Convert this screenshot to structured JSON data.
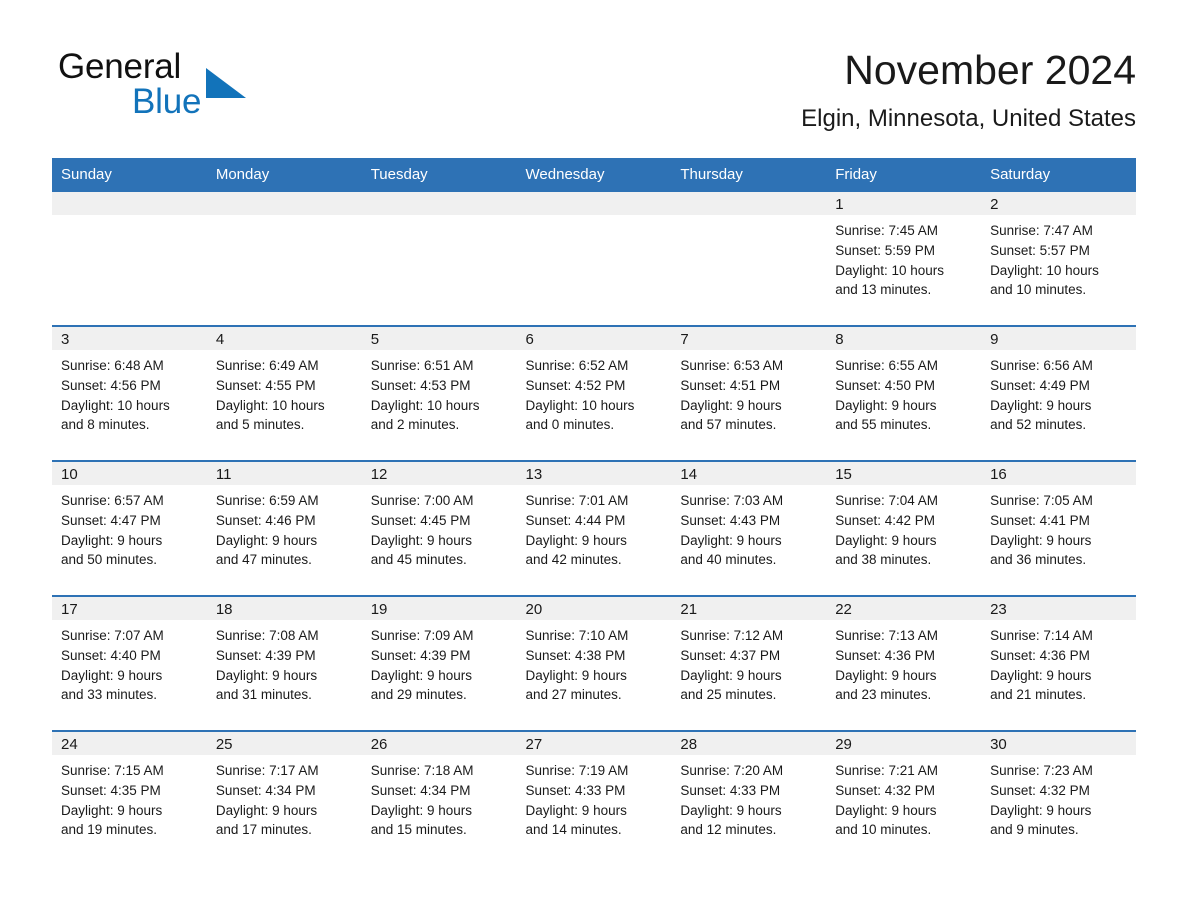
{
  "brand": {
    "line1": "General",
    "line2": "Blue",
    "accent_color": "#1273ba"
  },
  "header": {
    "title": "November 2024",
    "subtitle": "Elgin, Minnesota, United States"
  },
  "theme": {
    "header_row_bg": "#2e72b5",
    "date_band_bg": "#f0f0f0",
    "separator_color": "#2e72b5",
    "text_color": "#1a1a1a"
  },
  "weekdays": [
    "Sunday",
    "Monday",
    "Tuesday",
    "Wednesday",
    "Thursday",
    "Friday",
    "Saturday"
  ],
  "weeks": [
    [
      {
        "date": "",
        "empty": true
      },
      {
        "date": "",
        "empty": true
      },
      {
        "date": "",
        "empty": true
      },
      {
        "date": "",
        "empty": true
      },
      {
        "date": "",
        "empty": true
      },
      {
        "date": "1",
        "sunrise": "Sunrise: 7:45 AM",
        "sunset": "Sunset: 5:59 PM",
        "daylight_line1": "Daylight: 10 hours",
        "daylight_line2": "and 13 minutes."
      },
      {
        "date": "2",
        "sunrise": "Sunrise: 7:47 AM",
        "sunset": "Sunset: 5:57 PM",
        "daylight_line1": "Daylight: 10 hours",
        "daylight_line2": "and 10 minutes."
      }
    ],
    [
      {
        "date": "3",
        "sunrise": "Sunrise: 6:48 AM",
        "sunset": "Sunset: 4:56 PM",
        "daylight_line1": "Daylight: 10 hours",
        "daylight_line2": "and 8 minutes."
      },
      {
        "date": "4",
        "sunrise": "Sunrise: 6:49 AM",
        "sunset": "Sunset: 4:55 PM",
        "daylight_line1": "Daylight: 10 hours",
        "daylight_line2": "and 5 minutes."
      },
      {
        "date": "5",
        "sunrise": "Sunrise: 6:51 AM",
        "sunset": "Sunset: 4:53 PM",
        "daylight_line1": "Daylight: 10 hours",
        "daylight_line2": "and 2 minutes."
      },
      {
        "date": "6",
        "sunrise": "Sunrise: 6:52 AM",
        "sunset": "Sunset: 4:52 PM",
        "daylight_line1": "Daylight: 10 hours",
        "daylight_line2": "and 0 minutes."
      },
      {
        "date": "7",
        "sunrise": "Sunrise: 6:53 AM",
        "sunset": "Sunset: 4:51 PM",
        "daylight_line1": "Daylight: 9 hours",
        "daylight_line2": "and 57 minutes."
      },
      {
        "date": "8",
        "sunrise": "Sunrise: 6:55 AM",
        "sunset": "Sunset: 4:50 PM",
        "daylight_line1": "Daylight: 9 hours",
        "daylight_line2": "and 55 minutes."
      },
      {
        "date": "9",
        "sunrise": "Sunrise: 6:56 AM",
        "sunset": "Sunset: 4:49 PM",
        "daylight_line1": "Daylight: 9 hours",
        "daylight_line2": "and 52 minutes."
      }
    ],
    [
      {
        "date": "10",
        "sunrise": "Sunrise: 6:57 AM",
        "sunset": "Sunset: 4:47 PM",
        "daylight_line1": "Daylight: 9 hours",
        "daylight_line2": "and 50 minutes."
      },
      {
        "date": "11",
        "sunrise": "Sunrise: 6:59 AM",
        "sunset": "Sunset: 4:46 PM",
        "daylight_line1": "Daylight: 9 hours",
        "daylight_line2": "and 47 minutes."
      },
      {
        "date": "12",
        "sunrise": "Sunrise: 7:00 AM",
        "sunset": "Sunset: 4:45 PM",
        "daylight_line1": "Daylight: 9 hours",
        "daylight_line2": "and 45 minutes."
      },
      {
        "date": "13",
        "sunrise": "Sunrise: 7:01 AM",
        "sunset": "Sunset: 4:44 PM",
        "daylight_line1": "Daylight: 9 hours",
        "daylight_line2": "and 42 minutes."
      },
      {
        "date": "14",
        "sunrise": "Sunrise: 7:03 AM",
        "sunset": "Sunset: 4:43 PM",
        "daylight_line1": "Daylight: 9 hours",
        "daylight_line2": "and 40 minutes."
      },
      {
        "date": "15",
        "sunrise": "Sunrise: 7:04 AM",
        "sunset": "Sunset: 4:42 PM",
        "daylight_line1": "Daylight: 9 hours",
        "daylight_line2": "and 38 minutes."
      },
      {
        "date": "16",
        "sunrise": "Sunrise: 7:05 AM",
        "sunset": "Sunset: 4:41 PM",
        "daylight_line1": "Daylight: 9 hours",
        "daylight_line2": "and 36 minutes."
      }
    ],
    [
      {
        "date": "17",
        "sunrise": "Sunrise: 7:07 AM",
        "sunset": "Sunset: 4:40 PM",
        "daylight_line1": "Daylight: 9 hours",
        "daylight_line2": "and 33 minutes."
      },
      {
        "date": "18",
        "sunrise": "Sunrise: 7:08 AM",
        "sunset": "Sunset: 4:39 PM",
        "daylight_line1": "Daylight: 9 hours",
        "daylight_line2": "and 31 minutes."
      },
      {
        "date": "19",
        "sunrise": "Sunrise: 7:09 AM",
        "sunset": "Sunset: 4:39 PM",
        "daylight_line1": "Daylight: 9 hours",
        "daylight_line2": "and 29 minutes."
      },
      {
        "date": "20",
        "sunrise": "Sunrise: 7:10 AM",
        "sunset": "Sunset: 4:38 PM",
        "daylight_line1": "Daylight: 9 hours",
        "daylight_line2": "and 27 minutes."
      },
      {
        "date": "21",
        "sunrise": "Sunrise: 7:12 AM",
        "sunset": "Sunset: 4:37 PM",
        "daylight_line1": "Daylight: 9 hours",
        "daylight_line2": "and 25 minutes."
      },
      {
        "date": "22",
        "sunrise": "Sunrise: 7:13 AM",
        "sunset": "Sunset: 4:36 PM",
        "daylight_line1": "Daylight: 9 hours",
        "daylight_line2": "and 23 minutes."
      },
      {
        "date": "23",
        "sunrise": "Sunrise: 7:14 AM",
        "sunset": "Sunset: 4:36 PM",
        "daylight_line1": "Daylight: 9 hours",
        "daylight_line2": "and 21 minutes."
      }
    ],
    [
      {
        "date": "24",
        "sunrise": "Sunrise: 7:15 AM",
        "sunset": "Sunset: 4:35 PM",
        "daylight_line1": "Daylight: 9 hours",
        "daylight_line2": "and 19 minutes."
      },
      {
        "date": "25",
        "sunrise": "Sunrise: 7:17 AM",
        "sunset": "Sunset: 4:34 PM",
        "daylight_line1": "Daylight: 9 hours",
        "daylight_line2": "and 17 minutes."
      },
      {
        "date": "26",
        "sunrise": "Sunrise: 7:18 AM",
        "sunset": "Sunset: 4:34 PM",
        "daylight_line1": "Daylight: 9 hours",
        "daylight_line2": "and 15 minutes."
      },
      {
        "date": "27",
        "sunrise": "Sunrise: 7:19 AM",
        "sunset": "Sunset: 4:33 PM",
        "daylight_line1": "Daylight: 9 hours",
        "daylight_line2": "and 14 minutes."
      },
      {
        "date": "28",
        "sunrise": "Sunrise: 7:20 AM",
        "sunset": "Sunset: 4:33 PM",
        "daylight_line1": "Daylight: 9 hours",
        "daylight_line2": "and 12 minutes."
      },
      {
        "date": "29",
        "sunrise": "Sunrise: 7:21 AM",
        "sunset": "Sunset: 4:32 PM",
        "daylight_line1": "Daylight: 9 hours",
        "daylight_line2": "and 10 minutes."
      },
      {
        "date": "30",
        "sunrise": "Sunrise: 7:23 AM",
        "sunset": "Sunset: 4:32 PM",
        "daylight_line1": "Daylight: 9 hours",
        "daylight_line2": "and 9 minutes."
      }
    ]
  ]
}
